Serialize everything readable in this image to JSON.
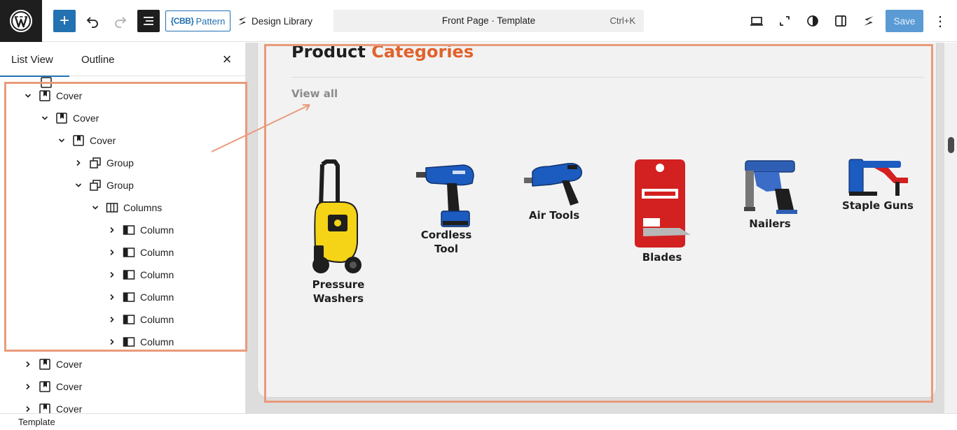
{
  "toolbar": {
    "pattern_prefix": "{CBB}",
    "pattern_label": "Pattern",
    "design_library_label": "Design Library",
    "document_title": "Front Page · Template",
    "command_shortcut": "Ctrl+K",
    "save_label": "Save",
    "options_glyph": "⋮",
    "add_glyph": "+"
  },
  "sidebar": {
    "tabs": [
      {
        "label": "List View",
        "active": true
      },
      {
        "label": "Outline",
        "active": false
      }
    ],
    "close_glyph": "×",
    "tree": [
      {
        "label": "Cover",
        "icon": "cover-icon",
        "level": 1,
        "expanded": true
      },
      {
        "label": "Cover",
        "icon": "cover-icon",
        "level": 2,
        "expanded": true
      },
      {
        "label": "Cover",
        "icon": "cover-icon",
        "level": 3,
        "expanded": true
      },
      {
        "label": "Group",
        "icon": "group-icon",
        "level": 4,
        "expanded": false
      },
      {
        "label": "Group",
        "icon": "group-icon",
        "level": 4,
        "expanded": true
      },
      {
        "label": "Columns",
        "icon": "columns-icon",
        "level": 5,
        "expanded": true
      },
      {
        "label": "Column",
        "icon": "column-icon",
        "level": 6,
        "expanded": false
      },
      {
        "label": "Column",
        "icon": "column-icon",
        "level": 6,
        "expanded": false
      },
      {
        "label": "Column",
        "icon": "column-icon",
        "level": 6,
        "expanded": false
      },
      {
        "label": "Column",
        "icon": "column-icon",
        "level": 6,
        "expanded": false
      },
      {
        "label": "Column",
        "icon": "column-icon",
        "level": 6,
        "expanded": false
      },
      {
        "label": "Column",
        "icon": "column-icon",
        "level": 6,
        "expanded": false
      },
      {
        "label": "Cover",
        "icon": "cover-icon",
        "level": 1,
        "expanded": false
      },
      {
        "label": "Cover",
        "icon": "cover-icon",
        "level": 1,
        "expanded": false
      },
      {
        "label": "Cover",
        "icon": "cover-icon",
        "level": 1,
        "expanded": false
      }
    ]
  },
  "canvas": {
    "title_main": "Product",
    "title_accent": "Categories",
    "view_all": "View all",
    "categories": [
      {
        "line1": "Pressure",
        "line2": "Washers",
        "icon": "pressure-washer-icon"
      },
      {
        "line1": "Cordless",
        "line2": "Tool",
        "icon": "cordless-drill-icon"
      },
      {
        "line1": "Air Tools",
        "line2": "",
        "icon": "air-tool-icon"
      },
      {
        "line1": "Blades",
        "line2": "",
        "icon": "blades-icon"
      },
      {
        "line1": "Nailers",
        "line2": "",
        "icon": "nailer-icon"
      },
      {
        "line1": "Staple Guns",
        "line2": "",
        "icon": "staple-gun-icon"
      }
    ]
  },
  "footer": {
    "breadcrumb": "Template"
  },
  "colors": {
    "accent": "#e0622d",
    "primary": "#2271b1",
    "highlight": "#ea9a7b",
    "dark": "#1e1e1e"
  }
}
